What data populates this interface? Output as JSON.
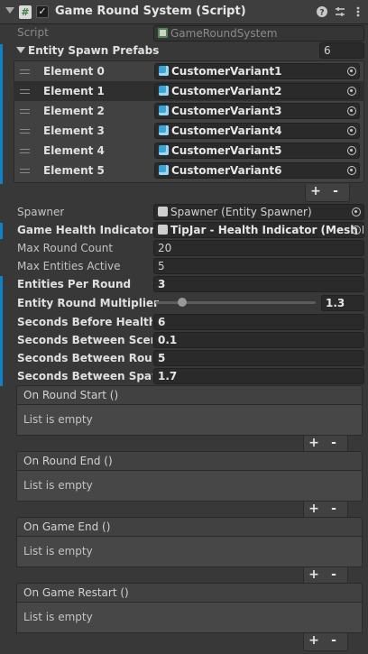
{
  "header": {
    "title": "Game Round System (Script)",
    "enabled_check": "✓",
    "script_glyph": "#",
    "icons": [
      "help-icon",
      "presets-icon",
      "more-icon"
    ]
  },
  "script_field": {
    "label": "Script",
    "value": "GameRoundSystem"
  },
  "entity_spawn_prefabs": {
    "label": "Entity Spawn Prefabs",
    "size": "6",
    "elements": [
      {
        "label": "Element 0",
        "value": "CustomerVariant1"
      },
      {
        "label": "Element 1",
        "value": "CustomerVariant2"
      },
      {
        "label": "Element 2",
        "value": "CustomerVariant3"
      },
      {
        "label": "Element 3",
        "value": "CustomerVariant4"
      },
      {
        "label": "Element 4",
        "value": "CustomerVariant5"
      },
      {
        "label": "Element 5",
        "value": "CustomerVariant6"
      }
    ]
  },
  "buttons": {
    "plus": "+",
    "minus": "-"
  },
  "fields": {
    "spawner": {
      "label": "Spawner",
      "value": "Spawner (Entity Spawner)"
    },
    "game_health_indicator": {
      "label": "Game Health Indicator",
      "value": "TipJar - Health Indicator (Mesh He"
    },
    "max_round_count": {
      "label": "Max Round Count",
      "value": "20"
    },
    "max_entities_active": {
      "label": "Max Entities Active",
      "value": "5"
    },
    "entities_per_round": {
      "label": "Entities Per Round",
      "value": "3"
    },
    "entity_round_multiplier": {
      "label": "Entity Round Multiplier",
      "value": "1.3"
    },
    "seconds_before_health": {
      "label": "Seconds Before Health Re",
      "value": "6"
    },
    "seconds_between_scene": {
      "label": "Seconds Between Scene S",
      "value": "0.1"
    },
    "seconds_between_rounds": {
      "label": "Seconds Between Rounds",
      "value": "5"
    },
    "seconds_between_spawns": {
      "label": "Seconds Between Spawns",
      "value": "1.7"
    }
  },
  "events": [
    {
      "title": "On Round Start ()",
      "body": "List is empty"
    },
    {
      "title": "On Round End ()",
      "body": "List is empty"
    },
    {
      "title": "On Game End ()",
      "body": "List is empty"
    },
    {
      "title": "On Game Restart ()",
      "body": "List is empty"
    }
  ],
  "colors": {
    "background": "#383838",
    "field": "#2a2a2a",
    "modified_bar": "#0f81c8"
  }
}
